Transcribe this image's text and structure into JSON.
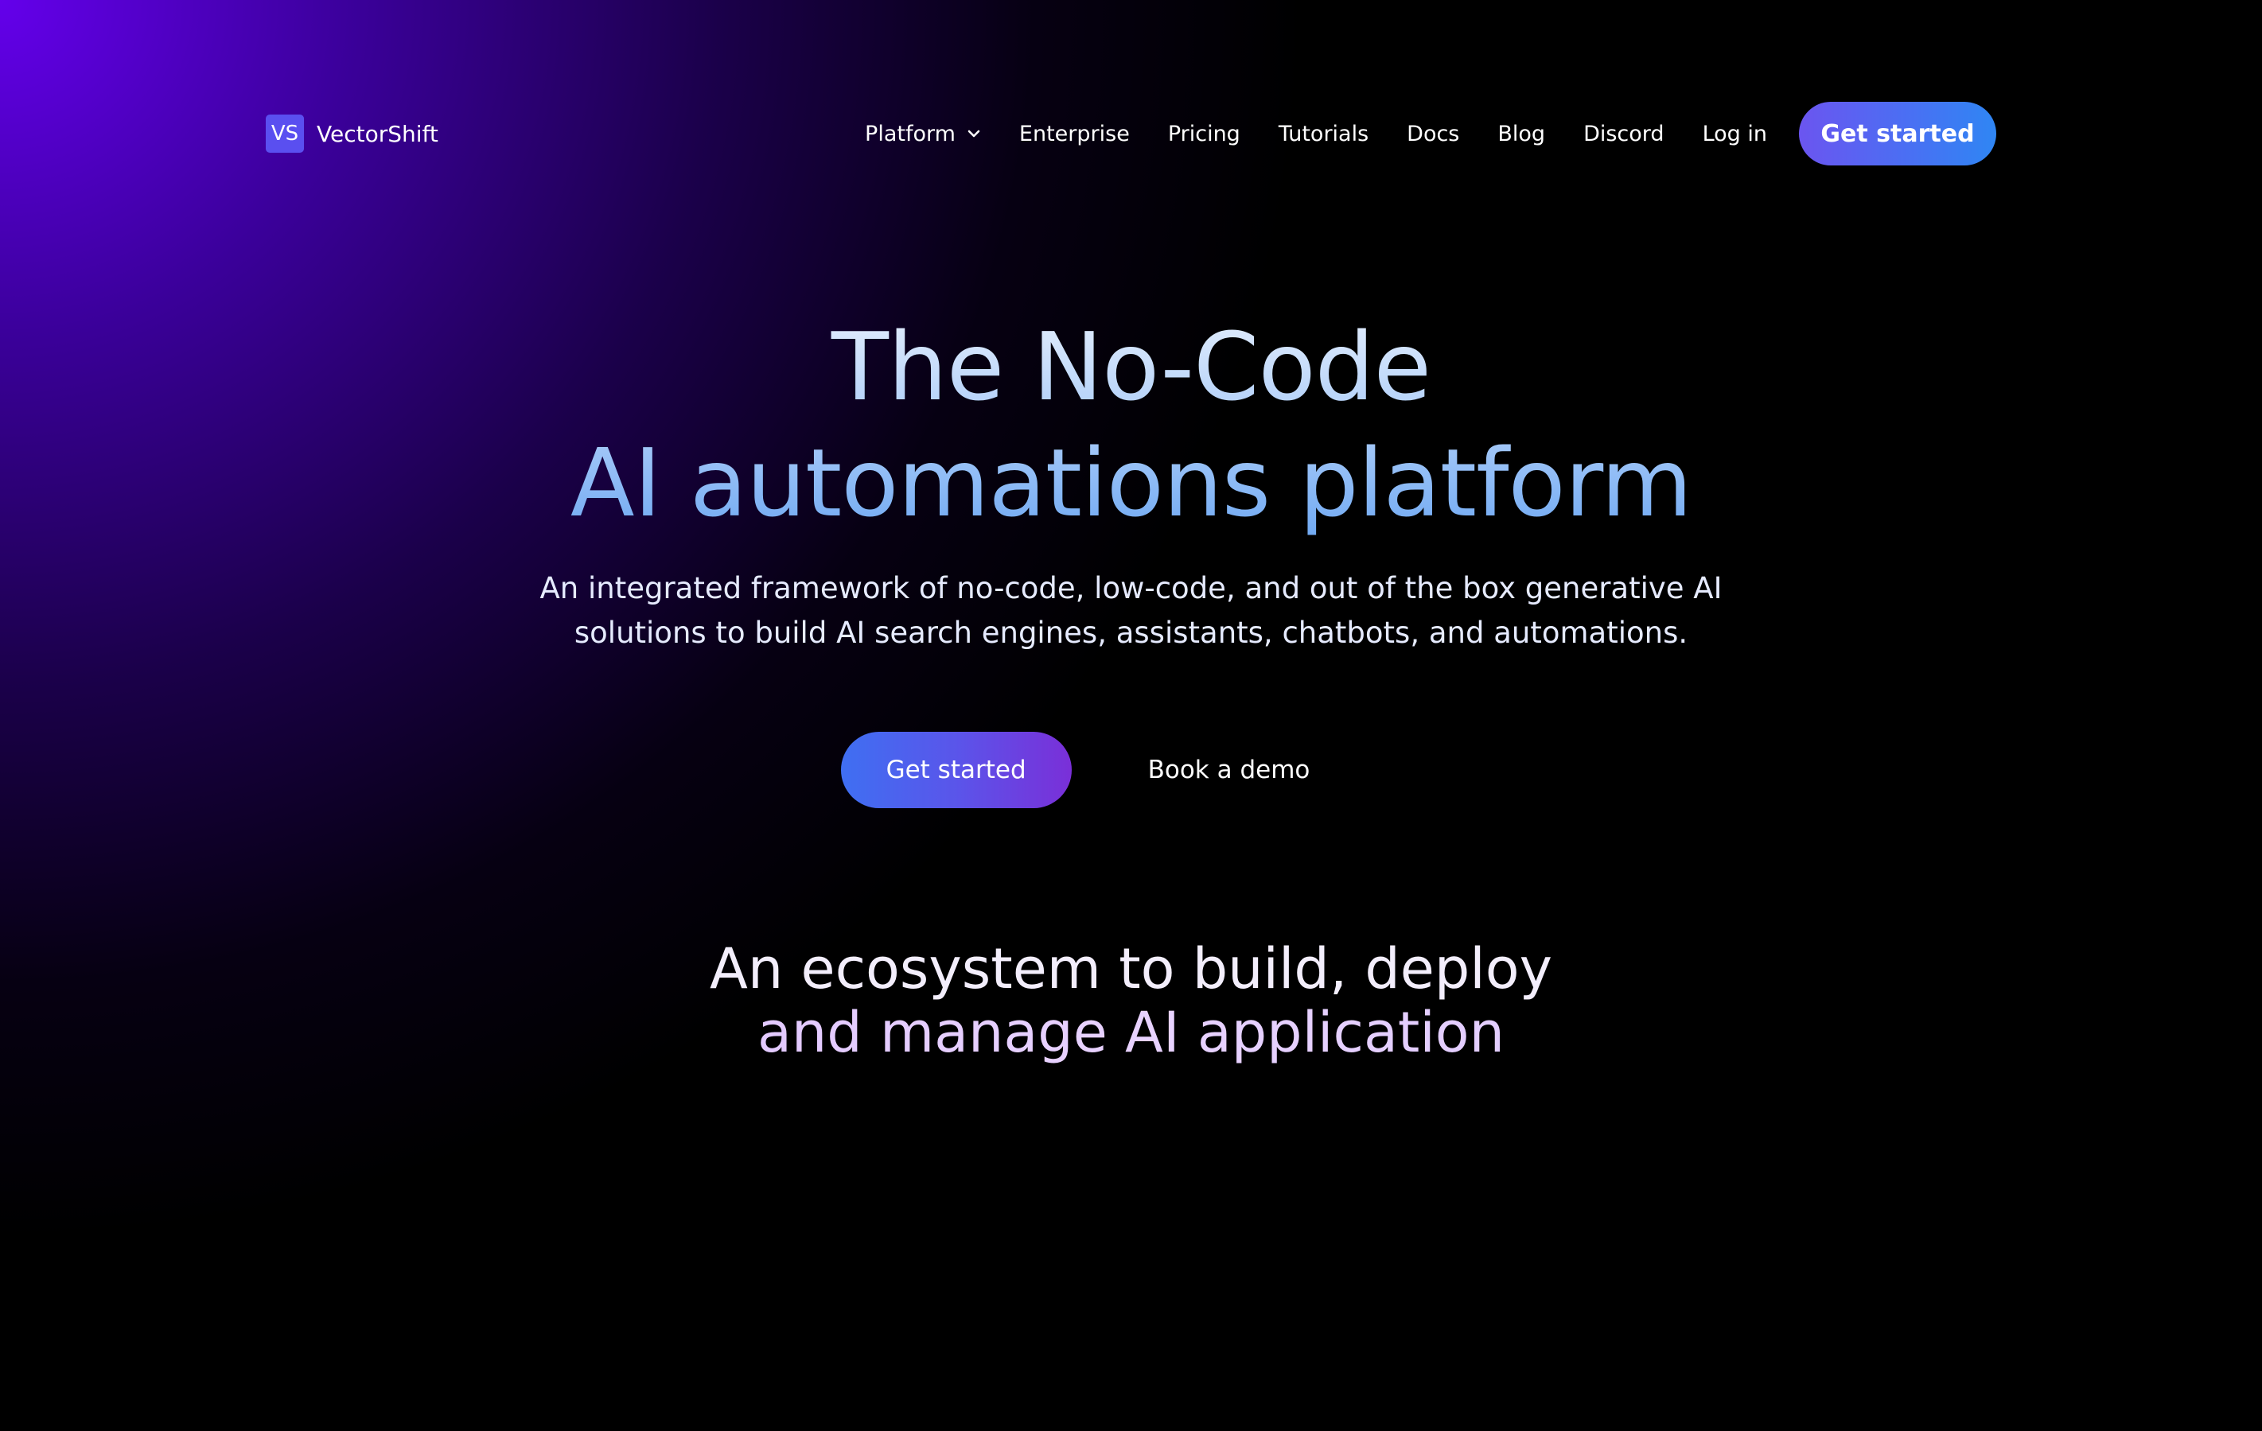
{
  "brand": {
    "logo_mark": "VS",
    "name": "VectorShift"
  },
  "nav": {
    "items": [
      {
        "label": "Platform",
        "has_dropdown": true
      },
      {
        "label": "Enterprise"
      },
      {
        "label": "Pricing"
      },
      {
        "label": "Tutorials"
      },
      {
        "label": "Docs"
      },
      {
        "label": "Blog"
      },
      {
        "label": "Discord"
      },
      {
        "label": "Log in"
      }
    ],
    "cta_label": "Get started"
  },
  "hero": {
    "title_line1": "The No-Code",
    "title_line2": "AI automations platform",
    "subtitle_line1": "An integrated framework of no-code, low-code, and out of the box generative AI",
    "subtitle_line2": "solutions to build AI search engines, assistants, chatbots, and automations.",
    "primary_cta": "Get started",
    "secondary_cta": "Book a demo"
  },
  "ecosystem": {
    "heading_line1": "An ecosystem to build, deploy",
    "heading_line2": "and manage AI application"
  },
  "colors": {
    "background": "#000000",
    "glow": "#6400eb",
    "accent_blue": "#2f86f3",
    "accent_purple": "#7a2fd8",
    "logo_mark_bg": "#5a4ff0"
  },
  "icons": {
    "platform_dropdown": "chevron-down-icon"
  }
}
